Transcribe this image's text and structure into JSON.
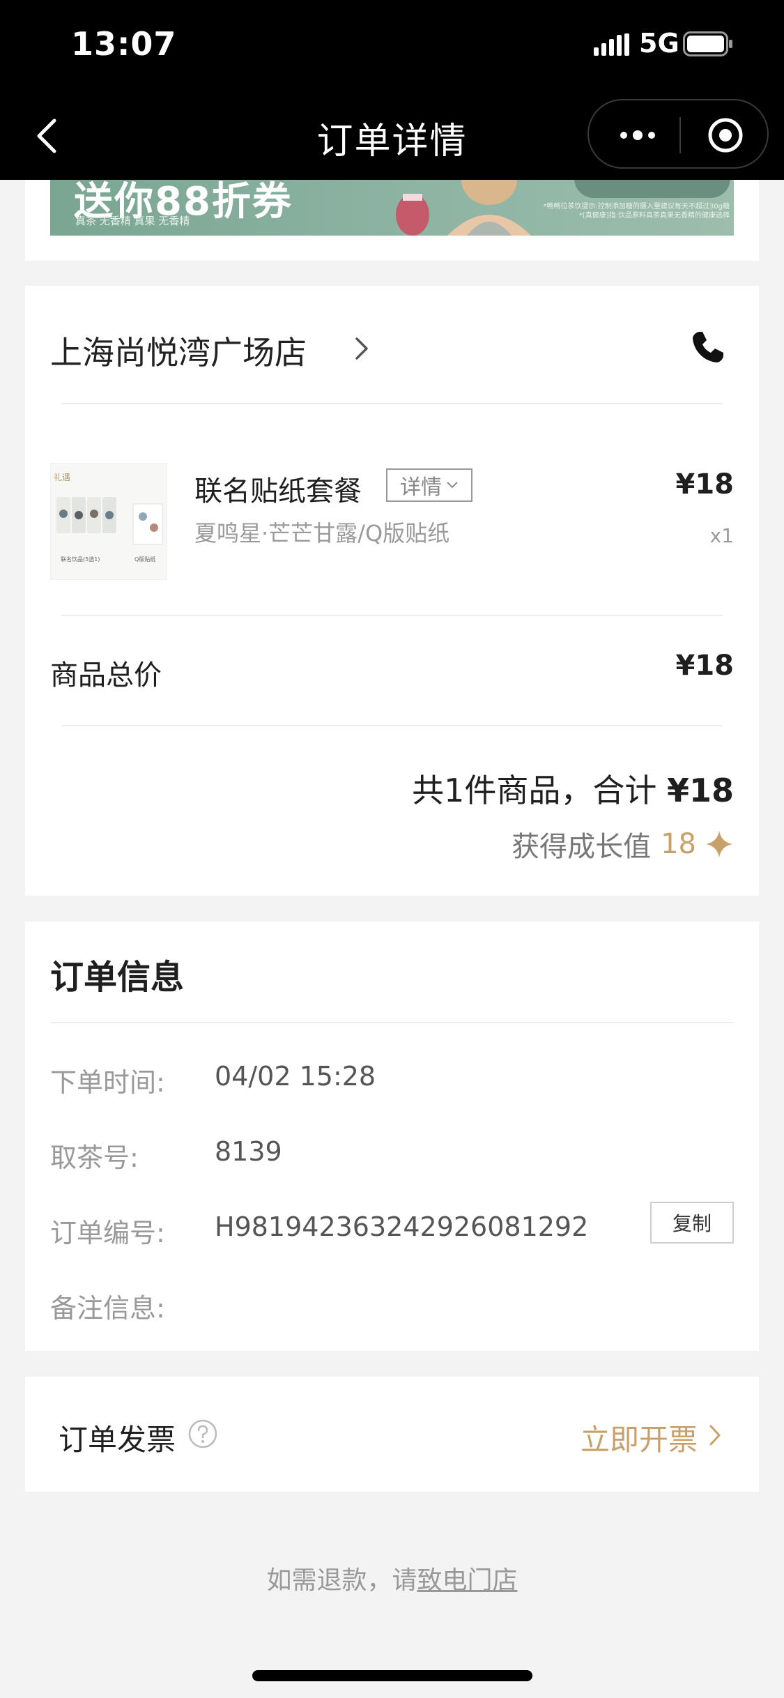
{
  "status_bar": {
    "time": "13:07",
    "network": "5G",
    "icons": [
      "signal-icon",
      "battery-icon"
    ]
  },
  "nav": {
    "title": "订单详情",
    "icons": [
      "back-icon",
      "more-icon",
      "close-mini-icon"
    ]
  },
  "banner": {
    "headline": "送你88折券",
    "subtext": "真茶 无香精  真果 无香精",
    "note": "*畅畅拉茶饮提示:控制添加糖的摄入量建议每天不超过30g糖 *[真健康]指:饮品原料真茶真果无香精的健康选择"
  },
  "store": {
    "name": "上海尚悦湾广场店",
    "icons": [
      "chevron-right-icon",
      "phone-icon"
    ]
  },
  "product": {
    "name": "联名贴纸套餐",
    "detail_label": "详情",
    "spec": "夏鸣星·芒芒甘露/Q版贴纸",
    "price": "¥18",
    "quantity": "x1",
    "image_labels": [
      "联名饮品(5选1)",
      "Q版贴纸"
    ]
  },
  "summary": {
    "subtotal_label": "商品总价",
    "subtotal_value": "¥18",
    "total_prefix": "共1件商品，合计",
    "total_amount": "¥18",
    "growth_label": "获得成长值",
    "growth_value": "18"
  },
  "order_info": {
    "title": "订单信息",
    "rows": [
      {
        "label": "下单时间:",
        "value": "04/02 15:28"
      },
      {
        "label": "取茶号:",
        "value": "8139"
      },
      {
        "label": "订单编号:",
        "value": "H981942363242926081292"
      },
      {
        "label": "备注信息:",
        "value": ""
      }
    ],
    "copy_label": "复制"
  },
  "invoice": {
    "label": "订单发票",
    "action": "立即开票"
  },
  "footer": {
    "refund_prefix": "如需退款，请",
    "refund_link": "致电门店"
  },
  "colors": {
    "accent_gold": "#c9a06a",
    "banner_green": "#8eb4a4",
    "nav_background": "#000000",
    "page_background": "#f3f3f3"
  }
}
